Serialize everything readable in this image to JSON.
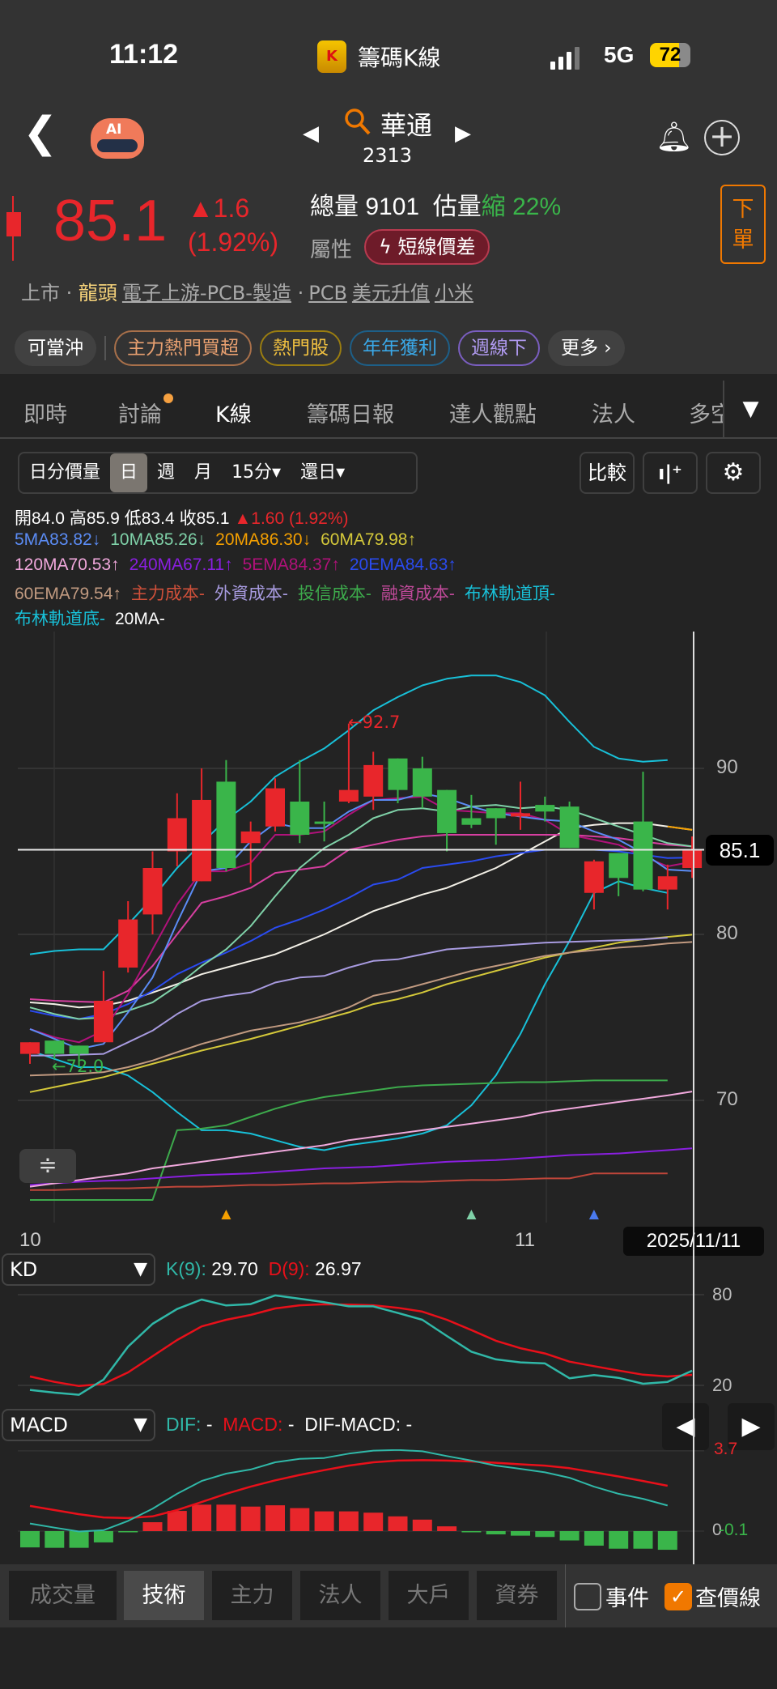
{
  "status_bar": {
    "time": "11:12",
    "app_name": "籌碼K線",
    "app_icon_letter": "K",
    "network": "5G",
    "battery": "72"
  },
  "nav": {
    "stock_name": "華通",
    "stock_code": "2313"
  },
  "quote": {
    "price": "85.1",
    "change": "▲1.6",
    "change_pct": "(1.92%)",
    "volume_label": "總量",
    "volume": "9101",
    "est_label": "估量",
    "est_dir": "縮",
    "est_pct": "22%",
    "attr_label": "屬性",
    "attr_pill": "短線價差",
    "order_button": "下\n單"
  },
  "tags": {
    "market": "上市",
    "dot": "·",
    "leader": "龍頭",
    "industry": "電子上游-PCB-製造",
    "dot2": "·",
    "t1": "PCB",
    "t2": "美元升值",
    "t3": "小米"
  },
  "chips": [
    {
      "label": "可當沖"
    },
    {
      "label": "主力熱門買超"
    },
    {
      "label": "熱門股"
    },
    {
      "label": "年年獲利"
    },
    {
      "label": "週線下"
    },
    {
      "label": "更多 ›"
    }
  ],
  "tabs": [
    {
      "label": "即時"
    },
    {
      "label": "討論"
    },
    {
      "label": "K線"
    },
    {
      "label": "籌碼日報"
    },
    {
      "label": "達人觀點"
    },
    {
      "label": "法人"
    },
    {
      "label": "多空"
    }
  ],
  "toolbar": {
    "periods": [
      "日分價量",
      "日",
      "週",
      "月",
      "15分▾",
      "還日▾"
    ],
    "compare": "比較"
  },
  "ohlc": {
    "open": "開84.0",
    "high": "高85.9",
    "low": "低83.4",
    "close": "收85.1",
    "change": "▲1.60 (1.92%)"
  },
  "legend": [
    {
      "text": "5MA83.82↓",
      "color": "#5b8cf5"
    },
    {
      "text": "10MA85.26↓",
      "color": "#7fd1a8"
    },
    {
      "text": "20MA86.30↓",
      "color": "#f5a000"
    },
    {
      "text": "60MA79.98↑",
      "color": "#d4c83a"
    },
    {
      "text": "120MA70.53↑",
      "color": "#f0a8dc"
    },
    {
      "text": "240MA67.11↑",
      "color": "#8a1fe0"
    },
    {
      "text": "5EMA84.37↑",
      "color": "#b0127a"
    },
    {
      "text": "20EMA84.63↑",
      "color": "#2a4bf0"
    },
    {
      "text": "60EMA79.54↑",
      "color": "#c19a80"
    },
    {
      "text": "主力成本-",
      "color": "#d0503a"
    },
    {
      "text": "外資成本-",
      "color": "#a89be0"
    },
    {
      "text": "投信成本-",
      "color": "#3daa4c"
    },
    {
      "text": "融資成本-",
      "color": "#c04a9a"
    },
    {
      "text": "布林軌道頂-",
      "color": "#18c0d8"
    },
    {
      "text": "布林軌道底-",
      "color": "#18c0d8"
    },
    {
      "text": "20MA-",
      "color": "#ffffff"
    }
  ],
  "chart_data": {
    "type": "candlestick",
    "y_ticks": [
      "90",
      "80",
      "70"
    ],
    "x_labels": [
      "10",
      "11"
    ],
    "ylim": [
      63.6,
      98.2
    ],
    "current_price_label": "85.1",
    "date_label": "2025/11/11",
    "high_annotation": "←92.7",
    "low_annotation": "←72.0",
    "up_color": "#e8262b",
    "down_color": "#3ab54a",
    "ohlc": [
      [
        72.8,
        73.5,
        72.2,
        73.5
      ],
      [
        73.6,
        73.6,
        72.5,
        72.8
      ],
      [
        73.3,
        73.3,
        72.0,
        72.8
      ],
      [
        73.5,
        77.8,
        73.5,
        76.0
      ],
      [
        78.0,
        82.0,
        77.7,
        80.9
      ],
      [
        81.2,
        85.0,
        80.0,
        84.0
      ],
      [
        85.0,
        88.5,
        84.1,
        87.0
      ],
      [
        83.2,
        90.0,
        83.2,
        88.1
      ],
      [
        89.2,
        90.5,
        83.8,
        84.0
      ],
      [
        85.5,
        86.8,
        83.1,
        86.2
      ],
      [
        86.5,
        89.4,
        86.2,
        88.8
      ],
      [
        88.0,
        90.5,
        85.5,
        86.0
      ],
      [
        86.8,
        88.0,
        85.6,
        86.7
      ],
      [
        88.0,
        92.7,
        87.9,
        88.7
      ],
      [
        88.3,
        91.0,
        87.5,
        90.2
      ],
      [
        90.6,
        90.6,
        87.9,
        88.7
      ],
      [
        90.0,
        90.7,
        87.6,
        88.3
      ],
      [
        88.7,
        88.7,
        85.0,
        86.1
      ],
      [
        87.0,
        88.4,
        86.4,
        86.6
      ],
      [
        87.6,
        87.6,
        85.4,
        87.0
      ],
      [
        87.1,
        89.2,
        86.3,
        87.3
      ],
      [
        87.8,
        88.3,
        86.8,
        87.4
      ],
      [
        87.7,
        88.0,
        85.2,
        85.2
      ],
      [
        82.5,
        84.5,
        81.5,
        84.4
      ],
      [
        84.9,
        84.9,
        82.3,
        83.4
      ],
      [
        86.8,
        89.8,
        82.6,
        82.7
      ],
      [
        82.7,
        84.2,
        81.5,
        83.5
      ],
      [
        84.0,
        85.9,
        83.4,
        85.1
      ]
    ],
    "lines": [
      {
        "key": "boll_top",
        "color": "#18c0d8",
        "values": [
          78.8,
          79.0,
          79.1,
          79.1,
          80.6,
          82.2,
          84.0,
          85.5,
          86.9,
          88.0,
          89.5,
          90.4,
          91.2,
          92.3,
          93.5,
          94.3,
          95.0,
          95.4,
          95.6,
          95.6,
          95.2,
          94.4,
          92.8,
          91.3,
          90.6,
          90.4,
          90.5,
          null
        ]
      },
      {
        "key": "boll_bottom",
        "color": "#18c0d8",
        "values": [
          73.0,
          72.5,
          72.0,
          72.0,
          71.5,
          70.5,
          69.3,
          68.2,
          68.2,
          68.0,
          67.6,
          67.2,
          67.0,
          67.3,
          67.5,
          67.7,
          68.0,
          68.5,
          69.7,
          71.5,
          74.0,
          77.0,
          79.6,
          82.5,
          83.2,
          82.8,
          82.5,
          null
        ]
      },
      {
        "key": "trust_cost",
        "color": "#3daa4c",
        "values": [
          64.0,
          64.0,
          64.0,
          64.0,
          64.0,
          64.0,
          68.2,
          68.3,
          68.5,
          69.0,
          69.5,
          69.9,
          70.2,
          70.4,
          70.6,
          70.8,
          70.9,
          70.95,
          71.0,
          71.05,
          71.1,
          71.1,
          71.15,
          71.2,
          71.2,
          71.2,
          71.2,
          null
        ]
      },
      {
        "key": "ma240",
        "color": "#8a1fe0",
        "values": [
          64.9,
          65.0,
          65.1,
          65.15,
          65.2,
          65.3,
          65.4,
          65.5,
          65.55,
          65.6,
          65.7,
          65.8,
          65.9,
          65.95,
          66.0,
          66.1,
          66.2,
          66.3,
          66.35,
          66.4,
          66.5,
          66.6,
          66.7,
          66.75,
          66.8,
          66.9,
          67.0,
          67.11
        ]
      },
      {
        "key": "main_cost",
        "color": "#c0463a",
        "values": [
          64.6,
          64.6,
          64.65,
          64.7,
          64.7,
          64.75,
          64.8,
          64.8,
          64.85,
          64.9,
          64.9,
          64.95,
          65.0,
          65.0,
          65.05,
          65.1,
          65.1,
          65.15,
          65.2,
          65.2,
          65.25,
          65.3,
          65.3,
          65.6,
          65.6,
          65.6,
          65.6,
          null
        ]
      },
      {
        "key": "ma120",
        "color": "#f0a8dc",
        "values": [
          64.8,
          65.0,
          65.2,
          65.4,
          65.6,
          65.9,
          66.1,
          66.3,
          66.5,
          66.7,
          66.9,
          67.1,
          67.3,
          67.6,
          67.8,
          68.0,
          68.2,
          68.4,
          68.6,
          68.8,
          69.0,
          69.3,
          69.5,
          69.7,
          69.9,
          70.1,
          70.3,
          70.53
        ]
      },
      {
        "key": "ma60",
        "color": "#d4c83a",
        "values": [
          70.5,
          70.8,
          71.1,
          71.4,
          71.8,
          72.2,
          72.6,
          73.0,
          73.35,
          73.7,
          74.1,
          74.5,
          74.9,
          75.3,
          75.8,
          76.1,
          76.5,
          77.0,
          77.4,
          77.8,
          78.2,
          78.6,
          78.9,
          79.2,
          79.5,
          79.7,
          79.85,
          79.98
        ]
      },
      {
        "key": "ema60",
        "color": "#c19a80",
        "values": [
          71.5,
          71.55,
          71.6,
          71.7,
          72.0,
          72.4,
          72.9,
          73.4,
          73.8,
          74.2,
          74.45,
          74.7,
          75.1,
          75.6,
          76.3,
          76.6,
          77.0,
          77.4,
          77.8,
          78.1,
          78.4,
          78.7,
          78.9,
          79.05,
          79.2,
          79.3,
          79.45,
          79.54
        ]
      },
      {
        "key": "foreign_cost",
        "color": "#a89be0",
        "values": [
          72.7,
          72.7,
          72.75,
          72.8,
          73.5,
          74.2,
          75.2,
          76.0,
          76.3,
          76.5,
          77.1,
          77.4,
          77.5,
          78.0,
          78.4,
          78.5,
          78.8,
          79.1,
          79.2,
          79.3,
          79.4,
          79.5,
          79.55,
          79.6,
          79.65,
          79.7,
          79.8,
          null
        ]
      },
      {
        "key": "ma20",
        "color": "#f2efe6",
        "values": [
          75.9,
          75.8,
          75.6,
          75.7,
          76.0,
          76.5,
          77.0,
          77.6,
          78.0,
          78.4,
          78.8,
          79.4,
          80.0,
          80.7,
          81.4,
          81.9,
          82.4,
          82.8,
          83.4,
          84.0,
          84.8,
          85.6,
          86.4,
          86.6,
          86.7,
          86.7,
          86.5,
          86.3
        ]
      },
      {
        "key": "ema20",
        "color": "#2a4bf0",
        "values": [
          75.4,
          75.1,
          74.9,
          75.2,
          75.8,
          76.6,
          77.6,
          78.3,
          78.9,
          79.6,
          80.4,
          80.9,
          81.5,
          82.2,
          83.0,
          83.3,
          84.0,
          84.2,
          84.4,
          84.7,
          84.9,
          85.1,
          85.1,
          85.1,
          85.0,
          84.8,
          84.6,
          84.63
        ]
      },
      {
        "key": "margin_cost",
        "color": "#d63fa0",
        "values": [
          76.1,
          76.0,
          75.95,
          75.9,
          76.6,
          78.1,
          80.0,
          81.9,
          82.3,
          82.8,
          83.7,
          83.9,
          84.1,
          85.1,
          85.4,
          85.7,
          85.9,
          86.0,
          86.0,
          86.0,
          86.0,
          86.0,
          86.0,
          85.9,
          85.8,
          85.6,
          85.4,
          85.3
        ]
      },
      {
        "key": "ma10",
        "color": "#7fd1a8",
        "values": [
          75.6,
          75.2,
          74.9,
          75.0,
          75.4,
          75.9,
          76.9,
          78.1,
          79.1,
          80.5,
          82.3,
          84.0,
          85.2,
          86.0,
          87.0,
          87.5,
          87.6,
          87.4,
          87.7,
          87.8,
          87.6,
          87.7,
          87.5,
          87.0,
          86.5,
          86.0,
          85.5,
          85.3
        ]
      },
      {
        "key": "ema5",
        "color": "#b0127a",
        "values": [
          74.3,
          73.8,
          73.5,
          74.2,
          76.4,
          79.1,
          81.8,
          83.8,
          83.8,
          84.3,
          86.0,
          86.0,
          86.2,
          87.2,
          88.1,
          88.2,
          88.3,
          87.5,
          87.4,
          87.3,
          87.3,
          86.9,
          86.0,
          85.7,
          85.4,
          84.7,
          84.1,
          84.37
        ]
      },
      {
        "key": "ma5",
        "color": "#5b8cf5",
        "values": [
          74.3,
          73.7,
          73.1,
          73.4,
          75.3,
          77.4,
          80.7,
          83.8,
          84.0,
          85.6,
          86.7,
          86.4,
          86.4,
          87.4,
          88.1,
          88.1,
          88.5,
          88.2,
          87.7,
          87.3,
          87.1,
          86.9,
          86.8,
          86.2,
          85.7,
          84.9,
          83.9,
          83.82
        ]
      }
    ],
    "event_markers": [
      {
        "index": 8,
        "color": "#f5a000"
      },
      {
        "index": 18,
        "color": "#7fd1a8"
      },
      {
        "index": 23,
        "color": "#4a7af0"
      }
    ]
  },
  "kd": {
    "selector": "KD",
    "k_label": "K(9):",
    "k_value": "29.70",
    "d_label": "D(9):",
    "d_value": "26.97",
    "ticks": [
      "80",
      "20"
    ],
    "k": [
      17,
      15.2,
      13.8,
      23.8,
      45.6,
      60.7,
      70.5,
      76.8,
      72.9,
      73.8,
      79.5,
      77.3,
      75,
      72.3,
      72.3,
      67.9,
      63.4,
      52.7,
      42.3,
      37.2,
      35.2,
      34.5,
      24.7,
      26.8,
      25,
      21.1,
      22.3,
      29.7
    ],
    "d": [
      25.9,
      22.3,
      19.6,
      20.9,
      28.6,
      39.3,
      50,
      59,
      63.4,
      66.6,
      70.9,
      73,
      73.6,
      73.4,
      73,
      71.3,
      68.8,
      63.4,
      56.6,
      49.5,
      44.6,
      41.1,
      35.7,
      32.7,
      29.8,
      27.1,
      25.9,
      26.97
    ]
  },
  "macd": {
    "selector": "MACD",
    "dif_label": "DIF:",
    "dif_value": "-",
    "macd_label": "MACD:",
    "macd_value": "-",
    "osc_label": "DIF-MACD:",
    "osc_value": "-",
    "tick_top": "3.7",
    "tick_zero": "0",
    "tick_bottom": "-0.1",
    "dif": [
      0.35,
      0.16,
      -0.02,
      0.04,
      0.47,
      1.03,
      1.72,
      2.31,
      2.65,
      2.84,
      3.17,
      3.33,
      3.37,
      3.57,
      3.71,
      3.74,
      3.68,
      3.46,
      3.25,
      3.02,
      2.87,
      2.71,
      2.46,
      2.05,
      1.72,
      1.49,
      1.18
    ],
    "signal": [
      1.16,
      0.97,
      0.78,
      0.63,
      0.6,
      0.68,
      0.97,
      1.34,
      1.72,
      2.05,
      2.34,
      2.59,
      2.81,
      3.02,
      3.17,
      3.25,
      3.27,
      3.25,
      3.21,
      3.15,
      3.08,
      3.02,
      2.9,
      2.71,
      2.52,
      2.31,
      2.09
    ],
    "hist": [
      -0.75,
      -0.77,
      -0.77,
      -0.52,
      -0.05,
      0.41,
      0.93,
      1.22,
      1.22,
      1.13,
      1.19,
      1.06,
      0.91,
      0.91,
      0.85,
      0.68,
      0.53,
      0.22,
      -0.02,
      -0.15,
      -0.21,
      -0.27,
      -0.43,
      -0.67,
      -0.81,
      -0.81,
      -0.86
    ]
  },
  "bottom_tabs": [
    {
      "label": "成交量"
    },
    {
      "label": "技術"
    },
    {
      "label": "主力"
    },
    {
      "label": "法人"
    },
    {
      "label": "大戶"
    },
    {
      "label": "資券"
    }
  ],
  "checkboxes": [
    {
      "label": "事件",
      "checked": false
    },
    {
      "label": "查價線",
      "checked": true
    }
  ]
}
